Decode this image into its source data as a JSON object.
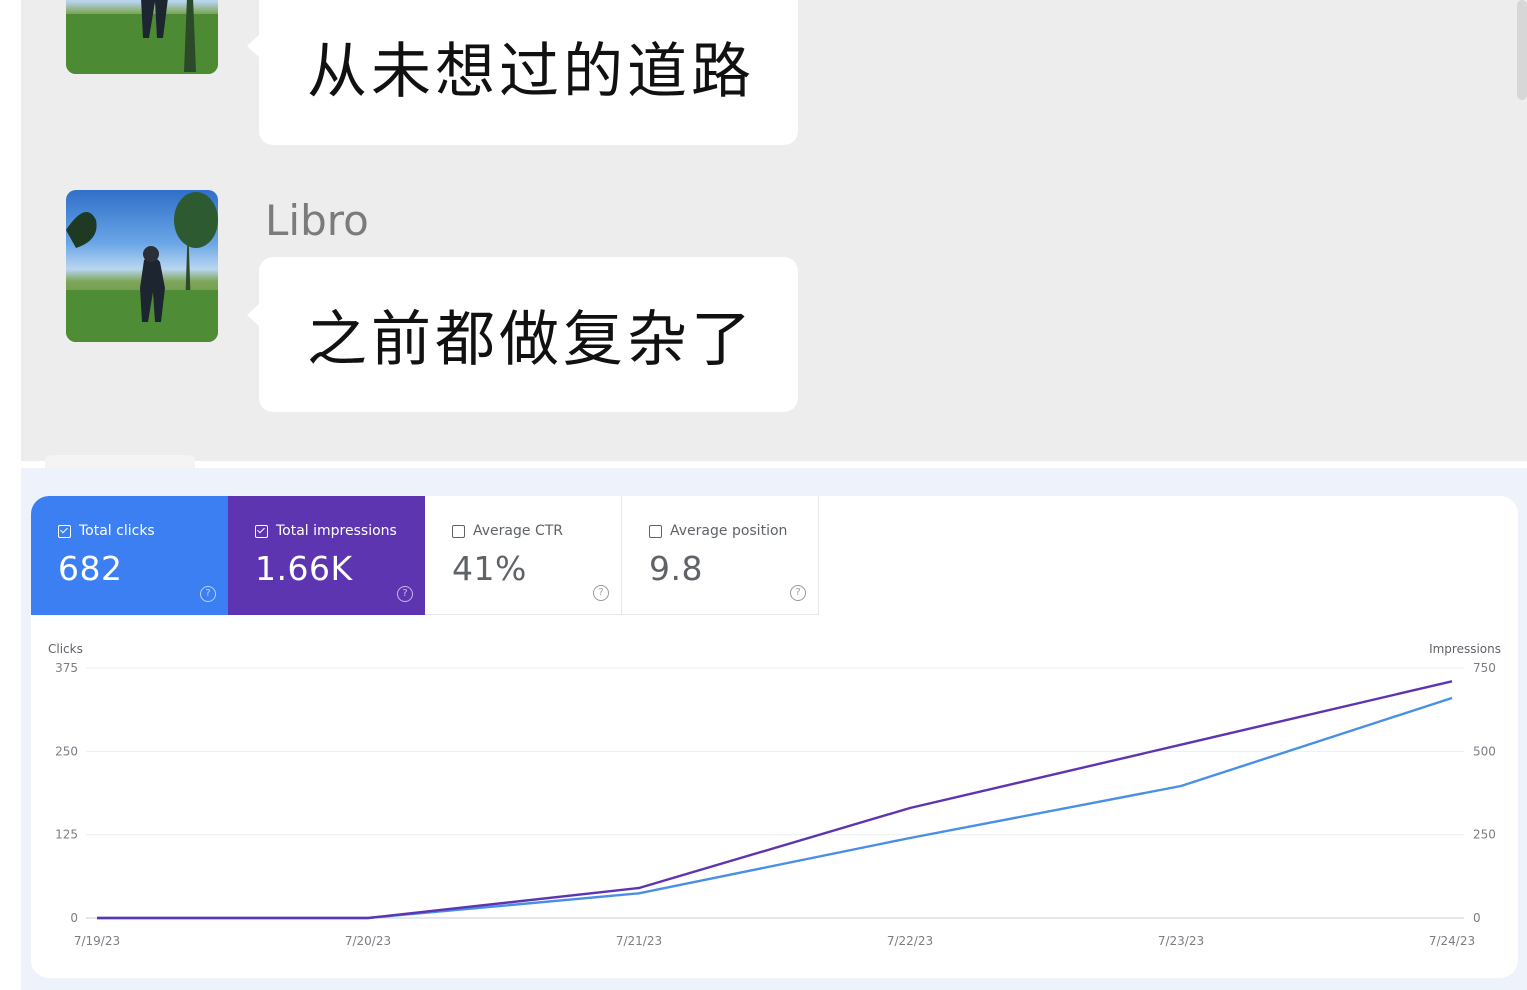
{
  "chat": {
    "messages": [
      {
        "sender": "",
        "text": "从未想过的道路"
      },
      {
        "sender": "Libro",
        "text": "之前都做复杂了"
      }
    ]
  },
  "metrics": [
    {
      "label": "Total clicks",
      "value": "682",
      "checked": true,
      "color": "#3b7ff2",
      "help": "?"
    },
    {
      "label": "Total impressions",
      "value": "1.66K",
      "checked": true,
      "color": "#5e35b1",
      "help": "?"
    },
    {
      "label": "Average CTR",
      "value": "41%",
      "checked": false,
      "help": "?"
    },
    {
      "label": "Average position",
      "value": "9.8",
      "checked": false,
      "help": "?"
    }
  ],
  "chart_data": {
    "type": "line",
    "x": [
      "7/19/23",
      "7/20/23",
      "7/21/23",
      "7/22/23",
      "7/23/23",
      "7/24/23"
    ],
    "left_axis": {
      "label": "Clicks",
      "ticks": [
        "0",
        "125",
        "250",
        "375"
      ],
      "ylim": [
        0,
        375
      ]
    },
    "right_axis": {
      "label": "Impressions",
      "ticks": [
        "0",
        "250",
        "500",
        "750"
      ],
      "ylim": [
        0,
        750
      ]
    },
    "series": [
      {
        "name": "Clicks",
        "axis": "left",
        "color": "#4a8fe7",
        "values": [
          0,
          0,
          37,
          120,
          198,
          330
        ]
      },
      {
        "name": "Impressions",
        "axis": "right",
        "color": "#5e35b1",
        "values": [
          0,
          0,
          90,
          330,
          520,
          710
        ]
      }
    ],
    "grid": true
  }
}
